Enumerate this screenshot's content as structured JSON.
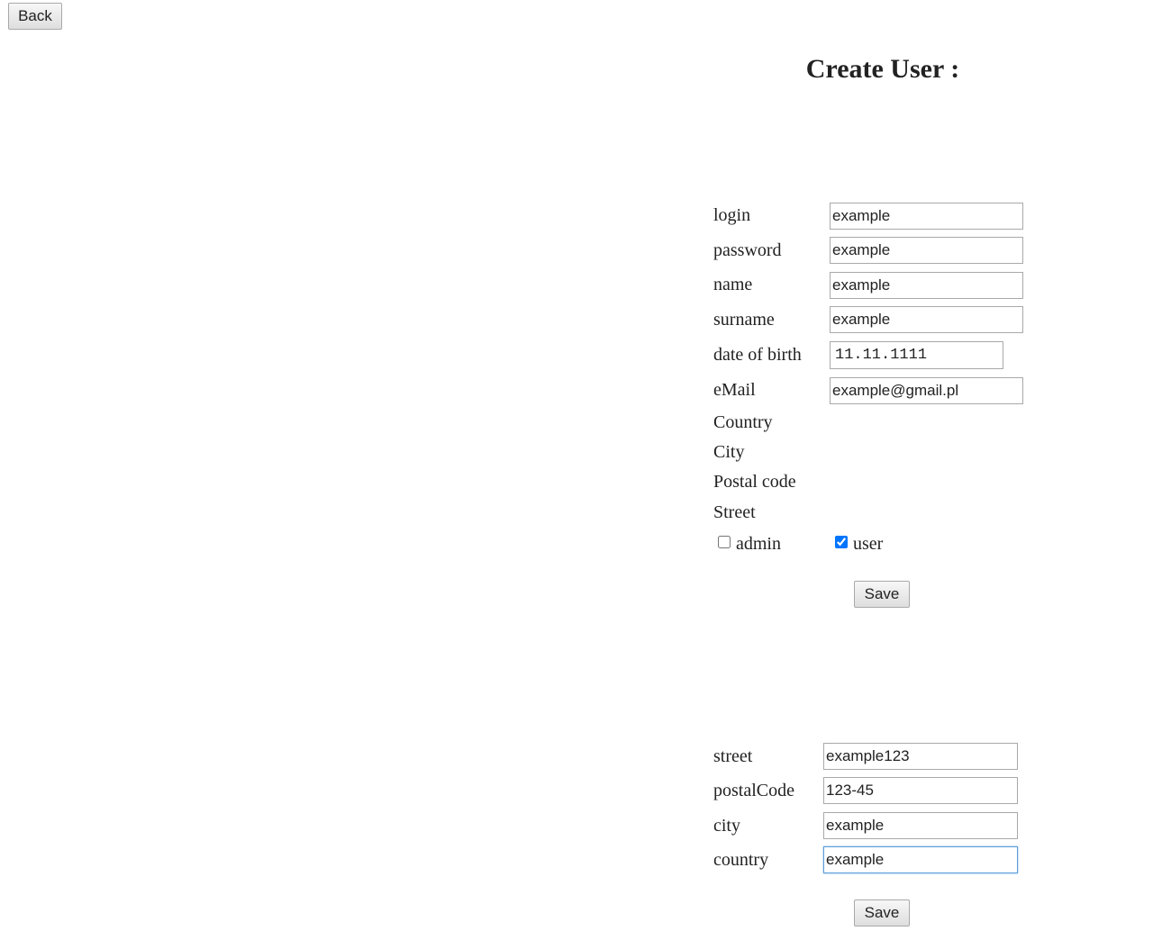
{
  "nav": {
    "back_label": "Back"
  },
  "page_title": "Create User :",
  "user_form": {
    "fields": {
      "login": {
        "label": "login",
        "value": "example"
      },
      "password": {
        "label": "password",
        "value": "example"
      },
      "name": {
        "label": "name",
        "value": "example"
      },
      "surname": {
        "label": "surname",
        "value": "example"
      },
      "dob": {
        "label": "date of birth",
        "value": "11.11.1111"
      },
      "email": {
        "label": "eMail",
        "value": "example@gmail.pl"
      }
    },
    "address_labels": {
      "country": "Country",
      "city": "City",
      "postal_code": "Postal code",
      "street": "Street"
    },
    "roles": {
      "admin": {
        "label": "admin",
        "checked": false
      },
      "user": {
        "label": "user",
        "checked": true
      }
    },
    "save_label": "Save"
  },
  "address_form": {
    "fields": {
      "street": {
        "label": "street",
        "value": "example123"
      },
      "postal_code": {
        "label": "postalCode",
        "value": "123-45"
      },
      "city": {
        "label": "city",
        "value": "example"
      },
      "country": {
        "label": "country",
        "value": "example"
      }
    },
    "save_label": "Save"
  }
}
